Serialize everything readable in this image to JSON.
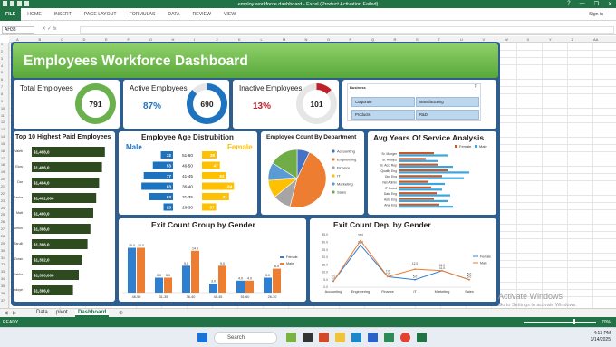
{
  "window": {
    "title": "employ workforce dashboard - Excel (Product Activation Failed)",
    "help": "?",
    "minimize": "—",
    "restore": "❐",
    "close": "✕"
  },
  "ribbon": {
    "file": "FILE",
    "tabs": [
      "HOME",
      "INSERT",
      "PAGE LAYOUT",
      "FORMULAS",
      "DATA",
      "REVIEW",
      "VIEW"
    ],
    "signin": "Sign in"
  },
  "formula": {
    "namebox": "AH38",
    "fx": "✕  ✓  fx"
  },
  "columns": [
    "A",
    "B",
    "C",
    "D",
    "E",
    "F",
    "G",
    "H",
    "I",
    "J",
    "K",
    "L",
    "M",
    "N",
    "O",
    "P",
    "Q",
    "R",
    "S",
    "T",
    "U",
    "V",
    "W",
    "X",
    "Y",
    "Z",
    "AA"
  ],
  "rows": [
    "1",
    "2",
    "3",
    "4",
    "5",
    "6",
    "7",
    "8",
    "9",
    "10",
    "11",
    "12",
    "13",
    "14",
    "15",
    "16",
    "17",
    "18",
    "19",
    "20",
    "21",
    "22",
    "23",
    "24",
    "25",
    "26",
    "27",
    "28",
    "29",
    "30",
    "31",
    "32",
    "33",
    "34",
    "35",
    "36",
    "37"
  ],
  "dashboard": {
    "title": "Employees  Workforce Dashboard",
    "kpis": [
      {
        "label": "Total Employees",
        "value": "791",
        "color": "#6ab04c"
      },
      {
        "label": "Active Employees",
        "pct": "87%",
        "value": "690",
        "color": "#1e73be",
        "pct_color": "#1e73be"
      },
      {
        "label": "Inactive Employees",
        "pct": "13%",
        "value": "101",
        "color": "#c0202a",
        "pct_color": "#c0202a"
      }
    ],
    "slicer": {
      "header": "Business",
      "clear": "⊽",
      "items": [
        "Corporate",
        "Manufacturing",
        "Products",
        "R&D"
      ]
    },
    "top10": {
      "title": "Top 10 Highest Paid Employees",
      "names": [
        "Valeb",
        "Elow",
        "Dar",
        "Sasha",
        "Matt",
        "Simon",
        "Tarulli",
        "Zoran",
        "Dahlia",
        "Kalendoye"
      ],
      "values": [
        "$1,408,0",
        "$1,406,0",
        "$1,404,0",
        "$1,402,000",
        "$1,400,0",
        "$1,398,0",
        "$1,396,0",
        "$1,392,0",
        "$1,390,000",
        "$1,386,0"
      ],
      "amounts": [
        1408,
        1406,
        1404,
        1402,
        1400,
        1398,
        1396,
        1392,
        1390,
        1386
      ]
    },
    "age": {
      "title": "Employee Age Distrubition",
      "male_label": "Male",
      "female_label": "Female",
      "bands": [
        "51-60",
        "46-50",
        "41-45",
        "36-40",
        "31-35",
        "26-30"
      ],
      "male": [
        "32",
        "53",
        "77",
        "83",
        "63",
        "25"
      ],
      "female": [
        "38",
        "47",
        "63",
        "84",
        "71",
        "37"
      ],
      "male_color": "#1e73be",
      "female_color": "#ffc000"
    },
    "dept": {
      "title": "Employee Count By Department",
      "legend": [
        "Accounting",
        "Engineering",
        "Finance",
        "IT",
        "Marketing",
        "Sales"
      ],
      "colors": [
        "#4472c4",
        "#ed7d31",
        "#a5a5a5",
        "#ffc000",
        "#5b9bd5",
        "#70ad47"
      ],
      "shares": [
        0.07,
        0.47,
        0.1,
        0.1,
        0.1,
        0.16
      ]
    },
    "service": {
      "title": "Avg Years Of Service Analysis",
      "legend": [
        "Female",
        "Male"
      ],
      "roles": [
        "Sr. Manger",
        "Sr. Analyst",
        "Sr. Acc. Rep",
        "Quality Eng",
        "Ops Eng",
        "Net Admin",
        "IT Coord",
        "Data Eng",
        "Auto Eng",
        "Anal Eng"
      ],
      "female": [
        6.5,
        5.0,
        7.2,
        9.0,
        8.0,
        5.5,
        6.0,
        7.0,
        6.5,
        7.5
      ],
      "male": [
        9.0,
        7.2,
        10.0,
        13.0,
        12.0,
        8.5,
        8.0,
        9.5,
        9.0,
        10.0
      ],
      "colors": [
        "#c55a28",
        "#3aa6e0"
      ]
    },
    "exit_gender": {
      "title": "Exit Count Group by Gender",
      "categories": [
        "46-50",
        "31-35",
        "36-40",
        "41-45",
        "51-60",
        "26-30"
      ],
      "female": [
        15.0,
        5.0,
        9.0,
        3.0,
        4.0,
        5.0
      ],
      "male": [
        15.0,
        5.0,
        14.0,
        9.0,
        4.0,
        8.0
      ],
      "female_labels": [
        "15.0",
        "5.0",
        "9.0",
        "3.0",
        "4.0",
        "5.0"
      ],
      "male_labels": [
        "15.0",
        "5.0",
        "14.0",
        "9.0",
        "4.0",
        "8.0"
      ],
      "legend": [
        "Female",
        "Male"
      ],
      "colors": [
        "#2f7fd1",
        "#ed7d31"
      ]
    },
    "exit_dept": {
      "title": "Exit Count Dep. by Gender",
      "categories": [
        "Accounting",
        "Engineering",
        "Finance",
        "IT",
        "Marketing",
        "Sales"
      ],
      "female": [
        4,
        28,
        7,
        5,
        11,
        5
      ],
      "male": [
        4,
        31,
        7,
        12,
        11,
        5
      ],
      "yticks": [
        "35.0",
        "30.0",
        "25.0",
        "20.0",
        "15.0",
        "10.0",
        "5.0",
        "0.0"
      ],
      "female_labels": [
        "4.0",
        "28.0",
        "7.0",
        "5.0",
        "11.0",
        "5.0"
      ],
      "male_labels": [
        "4.0",
        "31.0",
        "7.0",
        "12.0",
        "11.0",
        "5.0"
      ],
      "legend": [
        "Female",
        "Male"
      ],
      "colors": [
        "#2f7fd1",
        "#ed7d31"
      ]
    }
  },
  "sheets": {
    "data": "Data",
    "pivot": "pivot",
    "dashboard": "Dashboard",
    "add": "⊕"
  },
  "status": {
    "ready": "READY",
    "zoom": "70%"
  },
  "watermark": {
    "line1": "Activate Windows",
    "line2": "Go to Settings to activate Windows."
  },
  "taskbar": {
    "search": "Search",
    "time": "4:13 PM",
    "date": "3/14/2025"
  }
}
